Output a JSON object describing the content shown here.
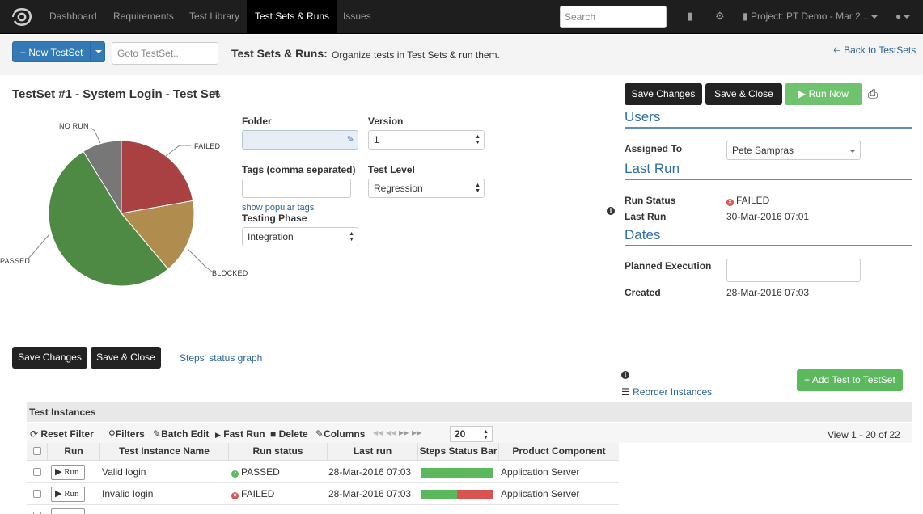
{
  "nav": {
    "items": [
      "Dashboard",
      "Requirements",
      "Test Library",
      "Test Sets & Runs",
      "Issues"
    ],
    "search_placeholder": "Search",
    "project_label": "Project: PT Demo - Mar 2..."
  },
  "subheader": {
    "new_testset_label": "+ New TestSet",
    "goto_placeholder": "Goto TestSet...",
    "title": "Test Sets & Runs:",
    "description": "Organize tests in Test Sets & run them.",
    "back_link": "Back to TestSets"
  },
  "testset": {
    "title": "TestSet #1 -  System Login - Test Set"
  },
  "pie": {
    "labels": {
      "no_run": "NO RUN",
      "failed": "FAILED",
      "blocked": "BLOCKED",
      "passed": "PASSED"
    },
    "colors": {
      "no_run": "#777777",
      "failed": "#a94042",
      "blocked": "#b08d4f",
      "passed": "#4f8a45"
    }
  },
  "form": {
    "folder_label": "Folder",
    "version_label": "Version",
    "version_value": "1",
    "tags_label": "Tags (comma separated)",
    "test_level_label": "Test Level",
    "test_level_value": "Regression",
    "show_popular_tags": "show popular tags",
    "testing_phase_label": "Testing Phase",
    "testing_phase_value": "Integration"
  },
  "actions": {
    "save_changes": "Save Changes",
    "save_close": "Save & Close",
    "run_now": "Run Now",
    "steps_graph": "Steps' status graph",
    "reorder": "Reorder Instances",
    "add_test": "+ Add Test to TestSet"
  },
  "right": {
    "users_heading": "Users",
    "assigned_to_label": "Assigned To",
    "assigned_to_value": "Pete Sampras",
    "last_run_heading": "Last Run",
    "run_status_label": "Run Status",
    "run_status_value": "FAILED",
    "last_run_label": "Last Run",
    "last_run_value": "30-Mar-2016 07:01",
    "dates_heading": "Dates",
    "planned_label": "Planned Execution",
    "created_label": "Created",
    "created_value": "28-Mar-2016 07:03"
  },
  "grid": {
    "title": "Test Instances",
    "toolbar": {
      "reset_filter": "Reset Filter",
      "filters": "Filters",
      "batch_edit": "Batch Edit",
      "fast_run": "Fast Run",
      "delete": "Delete",
      "columns": "Columns",
      "page_size": "20",
      "view_count": "View 1 - 20 of 22"
    },
    "columns": [
      "Run",
      "Test Instance Name",
      "Run status",
      "Last run",
      "Steps Status Bar",
      "Product Component"
    ],
    "rows": [
      {
        "run": "Run",
        "name": "Valid login",
        "status": "PASSED",
        "last_run": "28-Mar-2016  07:03",
        "component": "Application Server",
        "bar": [
          {
            "pct": 100,
            "color": "#5cb85c"
          }
        ]
      },
      {
        "run": "Run",
        "name": "Invalid login",
        "status": "FAILED",
        "last_run": "28-Mar-2016  07:03",
        "component": "Application Server",
        "bar": [
          {
            "pct": 50,
            "color": "#5cb85c"
          },
          {
            "pct": 50,
            "color": "#d9534f"
          }
        ]
      }
    ]
  }
}
